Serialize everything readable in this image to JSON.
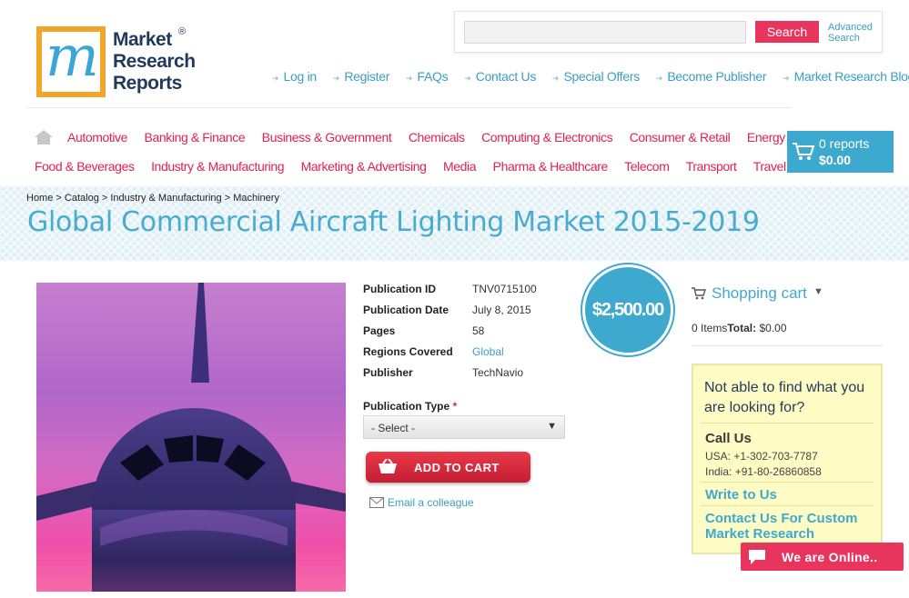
{
  "logo": {
    "line1": "Market",
    "line2": "Research",
    "line3": "Reports",
    "reg": "®"
  },
  "search": {
    "placeholder": "",
    "button": "Search",
    "advanced": "Advanced Search"
  },
  "top_links": [
    "Log in",
    "Register",
    "FAQs",
    "Contact Us",
    "Special Offers",
    "Become Publisher",
    "Market Research Blog"
  ],
  "categories_row1": [
    "Automotive",
    "Banking & Finance",
    "Business & Government",
    "Chemicals",
    "Computing & Electronics",
    "Consumer & Retail",
    "Energy & Utilities"
  ],
  "categories_row2": [
    "Food & Beverages",
    "Industry & Manufacturing",
    "Marketing & Advertising",
    "Media",
    "Pharma & Healthcare",
    "Telecom",
    "Transport",
    "Travel & Leisure"
  ],
  "cart_top": {
    "reports": "0 reports",
    "total": "$0.00"
  },
  "breadcrumb": [
    "Home",
    "Catalog",
    "Industry & Manufacturing",
    "Machinery"
  ],
  "page_title": "Global Commercial Aircraft Lighting Market 2015-2019",
  "details": [
    {
      "label": "Publication ID",
      "value": "TNV0715100"
    },
    {
      "label": "Publication Date",
      "value": "July 8, 2015"
    },
    {
      "label": "Pages",
      "value": "58"
    },
    {
      "label": "Regions Covered",
      "value": "Global"
    },
    {
      "label": "Publisher",
      "value": "TechNavio"
    }
  ],
  "publication_type": {
    "label": "Publication Type",
    "required": "*",
    "selected": "- Select -"
  },
  "add_to_cart": "ADD TO CART",
  "email_colleague": "Email a colleague",
  "price": "$2,500.00",
  "shopping_cart": {
    "title": "Shopping cart",
    "items": "0 Items",
    "total_label": "Total:",
    "total": "$0.00"
  },
  "help_box": {
    "question": "Not able to find what you are looking for?",
    "call_us": "Call Us",
    "usa": "USA: +1-302-703-7787",
    "india": "India: +91-80-26860858",
    "write_to_us": "Write to Us",
    "custom": "Contact Us For Custom Market Research"
  },
  "chat": "We are Online..",
  "colors": {
    "accent_blue": "#3ea9cf",
    "accent_pink": "#e0224f",
    "chat_pink": "#e8355e",
    "help_bg": "#fffbc4"
  },
  "icons": [
    "home-icon",
    "cart-icon",
    "basket-icon",
    "envelope-icon",
    "chat-icon",
    "chevron-down-icon",
    "arrow-icon"
  ]
}
